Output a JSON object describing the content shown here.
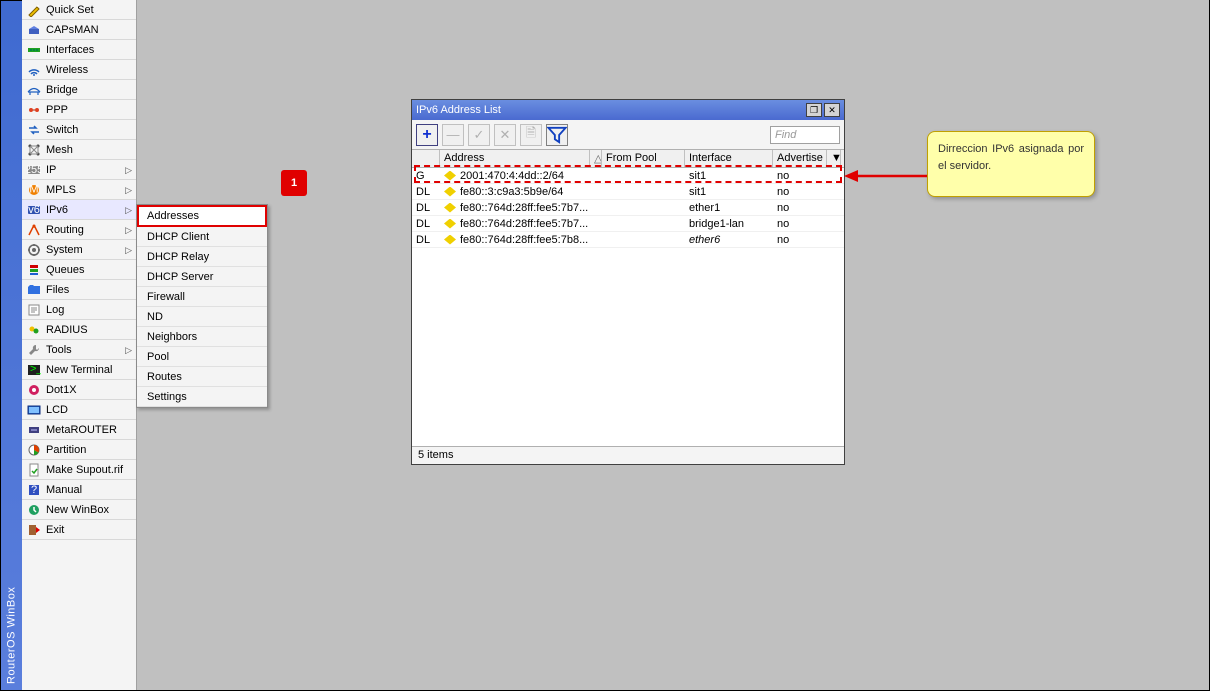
{
  "app_title": "RouterOS WinBox",
  "sidebar": {
    "items": [
      {
        "label": "Quick Set",
        "icon": "wand",
        "arrow": false
      },
      {
        "label": "CAPsMAN",
        "icon": "cap",
        "arrow": false
      },
      {
        "label": "Interfaces",
        "icon": "iface",
        "arrow": false
      },
      {
        "label": "Wireless",
        "icon": "wifi",
        "arrow": false
      },
      {
        "label": "Bridge",
        "icon": "bridge",
        "arrow": false
      },
      {
        "label": "PPP",
        "icon": "ppp",
        "arrow": false
      },
      {
        "label": "Switch",
        "icon": "switch",
        "arrow": false
      },
      {
        "label": "Mesh",
        "icon": "mesh",
        "arrow": false
      },
      {
        "label": "IP",
        "icon": "ip",
        "arrow": true
      },
      {
        "label": "MPLS",
        "icon": "mpls",
        "arrow": true
      },
      {
        "label": "IPv6",
        "icon": "ipv6",
        "arrow": true,
        "selected": true
      },
      {
        "label": "Routing",
        "icon": "routing",
        "arrow": true
      },
      {
        "label": "System",
        "icon": "system",
        "arrow": true
      },
      {
        "label": "Queues",
        "icon": "queues",
        "arrow": false
      },
      {
        "label": "Files",
        "icon": "files",
        "arrow": false
      },
      {
        "label": "Log",
        "icon": "log",
        "arrow": false
      },
      {
        "label": "RADIUS",
        "icon": "radius",
        "arrow": false
      },
      {
        "label": "Tools",
        "icon": "tools",
        "arrow": true
      },
      {
        "label": "New Terminal",
        "icon": "terminal",
        "arrow": false
      },
      {
        "label": "Dot1X",
        "icon": "dot1x",
        "arrow": false
      },
      {
        "label": "LCD",
        "icon": "lcd",
        "arrow": false
      },
      {
        "label": "MetaROUTER",
        "icon": "meta",
        "arrow": false
      },
      {
        "label": "Partition",
        "icon": "partition",
        "arrow": false
      },
      {
        "label": "Make Supout.rif",
        "icon": "supout",
        "arrow": false
      },
      {
        "label": "Manual",
        "icon": "manual",
        "arrow": false
      },
      {
        "label": "New WinBox",
        "icon": "winbox",
        "arrow": false
      },
      {
        "label": "Exit",
        "icon": "exit",
        "arrow": false
      }
    ]
  },
  "submenu": {
    "items": [
      {
        "label": "Addresses",
        "selected": true
      },
      {
        "label": "DHCP Client"
      },
      {
        "label": "DHCP Relay"
      },
      {
        "label": "DHCP Server"
      },
      {
        "label": "Firewall"
      },
      {
        "label": "ND"
      },
      {
        "label": "Neighbors"
      },
      {
        "label": "Pool"
      },
      {
        "label": "Routes"
      },
      {
        "label": "Settings"
      }
    ]
  },
  "marker1": "1",
  "window": {
    "title": "IPv6 Address List",
    "find_placeholder": "Find",
    "columns": {
      "flag": "",
      "address": "Address",
      "sort": "△",
      "pool": "From Pool",
      "interface": "Interface",
      "advertise": "Advertise",
      "drop": "▼"
    },
    "rows": [
      {
        "flag": "G",
        "address": "2001:470:4:4dd::2/64",
        "pool": "",
        "interface": "sit1",
        "advertise": "no",
        "italic": false
      },
      {
        "flag": "DL",
        "address": "fe80::3:c9a3:5b9e/64",
        "pool": "",
        "interface": "sit1",
        "advertise": "no",
        "italic": false
      },
      {
        "flag": "DL",
        "address": "fe80::764d:28ff:fee5:7b7...",
        "pool": "",
        "interface": "ether1",
        "advertise": "no",
        "italic": false
      },
      {
        "flag": "DL",
        "address": "fe80::764d:28ff:fee5:7b7...",
        "pool": "",
        "interface": "bridge1-lan",
        "advertise": "no",
        "italic": false
      },
      {
        "flag": "DL",
        "address": "fe80::764d:28ff:fee5:7b8...",
        "pool": "",
        "interface": "ether6",
        "advertise": "no",
        "italic_interface": true
      }
    ],
    "status": "5 items"
  },
  "callout": "Dirreccion IPv6 asignada por el servidor."
}
